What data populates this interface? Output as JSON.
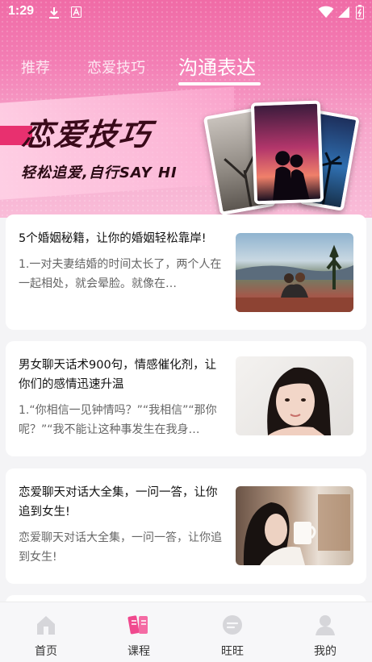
{
  "status_bar": {
    "time": "1:29"
  },
  "tabs": [
    {
      "label": "推荐",
      "active": false
    },
    {
      "label": "恋爱技巧",
      "active": false
    },
    {
      "label": "沟通表达",
      "active": true
    }
  ],
  "banner": {
    "title": "恋爱技巧",
    "subtitle": "轻松追爱,自行SAY  HI"
  },
  "articles": [
    {
      "title": "5个婚姻秘籍，让你的婚姻轻松靠岸!",
      "description": "1.一对夫妻结婚的时间太长了，两个人在一起相处，就会晕脸。就像在…",
      "image": "couple-on-hill"
    },
    {
      "title": "男女聊天话术900句，情感催化剂，让你们的感情迅速升温",
      "description": "1.“你相信一见钟情吗？”“我相信”“那你呢？”“我不能让这种事发生在我身…",
      "image": "woman-portrait"
    },
    {
      "title": "恋爱聊天对话大全集，一问一答，让你追到女生!",
      "description": "恋爱聊天对话大全集，一问一答，让你追到女生!",
      "image": "woman-with-cup"
    }
  ],
  "bottom_nav": [
    {
      "label": "首页",
      "icon": "home-icon",
      "active": false
    },
    {
      "label": "课程",
      "icon": "book-icon",
      "active": true
    },
    {
      "label": "旺旺",
      "icon": "chat-icon",
      "active": false
    },
    {
      "label": "我的",
      "icon": "user-icon",
      "active": false
    }
  ],
  "colors": {
    "accent": "#f06ba6",
    "active_nav": "#f0498e",
    "inactive_nav": "#d8d8dc"
  }
}
